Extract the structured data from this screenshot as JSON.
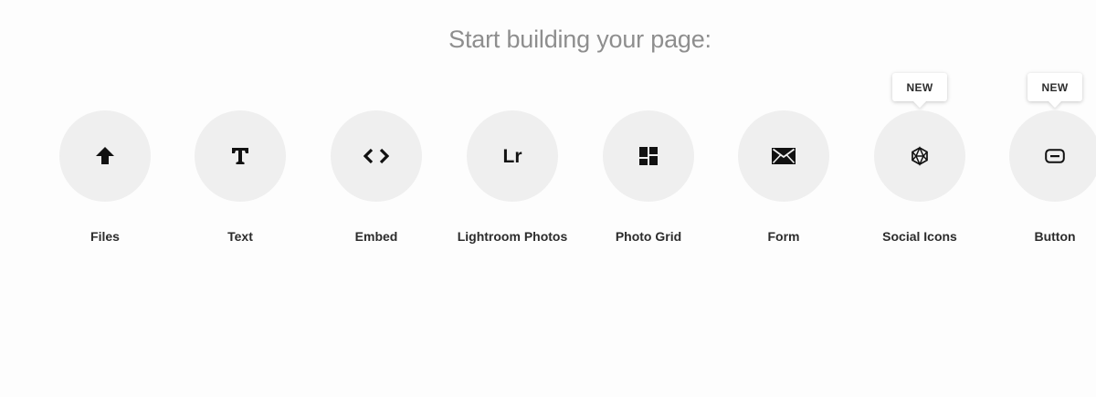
{
  "heading": "Start building your page:",
  "items": [
    {
      "label": "Files",
      "icon": "upload-arrow-icon",
      "badge": ""
    },
    {
      "label": "Text",
      "icon": "text-icon",
      "badge": ""
    },
    {
      "label": "Embed",
      "icon": "embed-code-icon",
      "badge": ""
    },
    {
      "label": "Lightroom Photos",
      "icon": "lightroom-icon",
      "badge": "",
      "glyph": "Lr"
    },
    {
      "label": "Photo Grid",
      "icon": "photo-grid-icon",
      "badge": ""
    },
    {
      "label": "Form",
      "icon": "envelope-icon",
      "badge": ""
    },
    {
      "label": "Social Icons",
      "icon": "social-network-icon",
      "badge": "NEW"
    },
    {
      "label": "Button",
      "icon": "button-icon",
      "badge": "NEW"
    }
  ],
  "colors": {
    "heading": "#8e8e8e",
    "circle": "#efefef",
    "label": "#2c2c2c",
    "icon": "#111111"
  }
}
